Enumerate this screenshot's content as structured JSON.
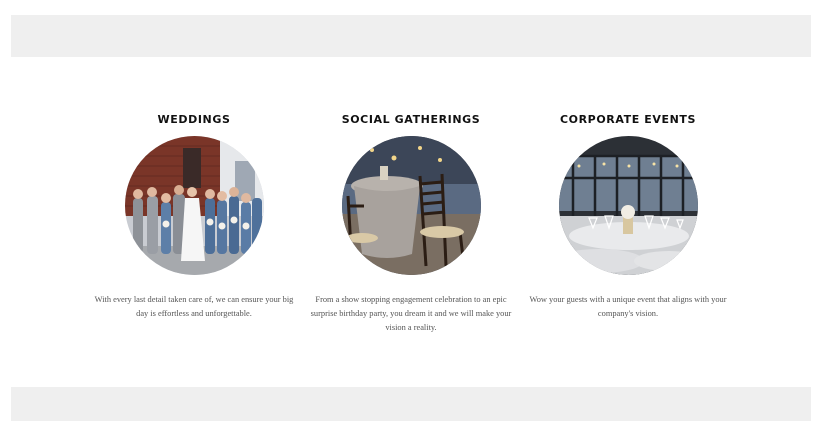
{
  "services": [
    {
      "title": "WEDDINGS",
      "description": "With every last detail taken care of, we can ensure your big day is effortless and unforgettable.",
      "image": "wedding-party-photo"
    },
    {
      "title": "SOCIAL GATHERINGS",
      "description": "From a show stopping engagement celebration to an epic surprise birthday party, you dream it and we will make your vision a reality.",
      "image": "chiavari-chairs-table-photo"
    },
    {
      "title": "CORPORATE EVENTS",
      "description": "Wow your guests with a unique event that aligns with your company's vision.",
      "image": "glass-pavilion-banquet-photo"
    }
  ]
}
